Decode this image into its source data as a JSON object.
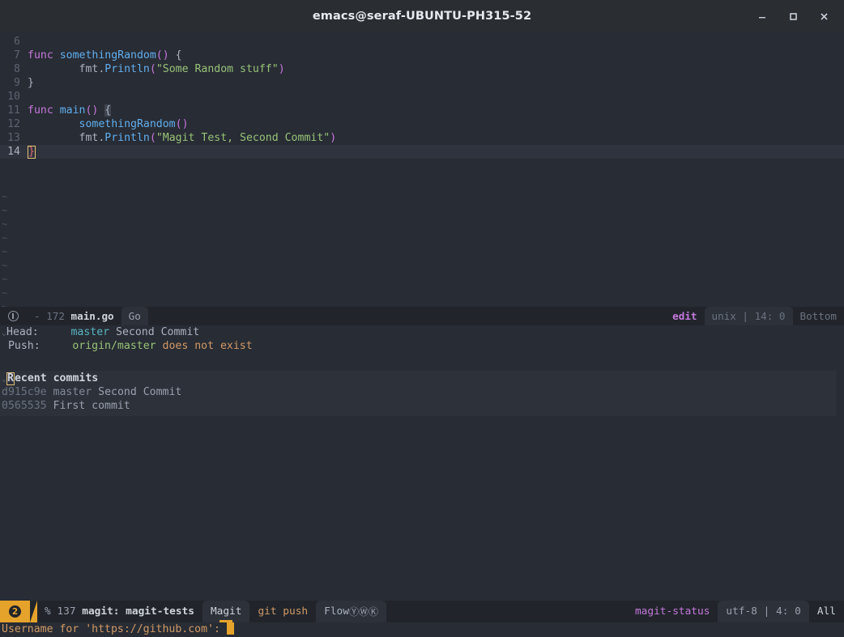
{
  "window": {
    "title": "emacs@seraf-UBUNTU-PH315-52",
    "minimize_label": "minimize",
    "maximize_label": "maximize",
    "close_label": "close"
  },
  "editor": {
    "lines": [
      {
        "num": "6",
        "tokens": []
      },
      {
        "num": "7",
        "tokens": [
          {
            "t": "func ",
            "c": "kw"
          },
          {
            "t": "somethingRandom",
            "c": "fn"
          },
          {
            "t": "() ",
            "c": "pun"
          },
          {
            "t": "{",
            "c": "brc"
          }
        ]
      },
      {
        "num": "8",
        "tokens": [
          {
            "t": "        fmt",
            "c": "pln"
          },
          {
            "t": ".",
            "c": "pln"
          },
          {
            "t": "Println",
            "c": "fn"
          },
          {
            "t": "(",
            "c": "pun"
          },
          {
            "t": "\"Some Random stuff\"",
            "c": "str"
          },
          {
            "t": ")",
            "c": "pun"
          }
        ]
      },
      {
        "num": "9",
        "tokens": [
          {
            "t": "}",
            "c": "brc"
          }
        ]
      },
      {
        "num": "10",
        "tokens": []
      },
      {
        "num": "11",
        "tokens": [
          {
            "t": "func ",
            "c": "kw"
          },
          {
            "t": "main",
            "c": "fn"
          },
          {
            "t": "() ",
            "c": "pun"
          },
          {
            "t": "{",
            "c": "brc-hl"
          }
        ]
      },
      {
        "num": "12",
        "tokens": [
          {
            "t": "        somethingRandom",
            "c": "fn"
          },
          {
            "t": "()",
            "c": "pun"
          }
        ]
      },
      {
        "num": "13",
        "tokens": [
          {
            "t": "        fmt",
            "c": "pln"
          },
          {
            "t": ".",
            "c": "pln"
          },
          {
            "t": "Println",
            "c": "fn"
          },
          {
            "t": "(",
            "c": "pun"
          },
          {
            "t": "\"Magit Test, Second Commit\"",
            "c": "str"
          },
          {
            "t": ")",
            "c": "pun"
          }
        ]
      },
      {
        "num": "14",
        "current": true,
        "cursor_char": "}",
        "tokens": []
      }
    ],
    "empty_line_marker": "~",
    "empty_line_count": 11
  },
  "modeline": {
    "dash": "-",
    "size": "172",
    "buffer": "main.go",
    "major_mode": "Go",
    "state": "edit",
    "coding": "unix | 14: 0",
    "position": "Bottom"
  },
  "magit": {
    "head_label": "Head:",
    "head_branch": "master",
    "head_message": "Second Commit",
    "push_label": "Push:",
    "push_remote": "origin/master",
    "push_status": "does not exist",
    "section_title": "Recent commits",
    "section_title_first_char": "R",
    "section_title_rest": "ecent commits",
    "commits": [
      {
        "hash": "d915c9e",
        "branch": "master",
        "message": "Second Commit"
      },
      {
        "hash": "0565535",
        "branch": "",
        "message": "First commit"
      }
    ]
  },
  "bottombar": {
    "window_number": "2",
    "process_indicator": "% 137",
    "buffer_name": "magit: magit-tests",
    "tab_magit": "Magit",
    "tab_git_push": "git push",
    "tab_flow": "Flow",
    "flow_badges": [
      "Ⓨ",
      "Ⓦ",
      "Ⓚ"
    ],
    "major_mode": "magit-status",
    "coding": "utf-8 | 4: 0",
    "position": "All"
  },
  "minibuffer": {
    "prompt": "Username for 'https://github.com': ",
    "value": ""
  }
}
